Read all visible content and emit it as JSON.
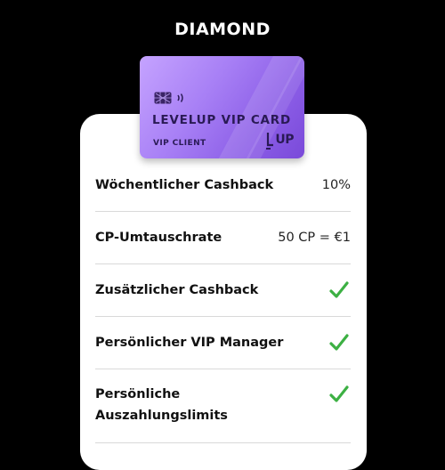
{
  "tier": {
    "title": "DIAMOND"
  },
  "card": {
    "title": "LEVELUP VIP CARD",
    "subtitle": "VIP CLIENT",
    "logo": "UP",
    "gradient_colors": [
      "#c5a3ff",
      "#7a4ad9"
    ]
  },
  "benefits": [
    {
      "label": "Wöchentlicher Cashback",
      "value": "10%"
    },
    {
      "label": "CP-Umtauschrate",
      "value": "50 CP = €1"
    },
    {
      "label": "Zusätzlicher Cashback",
      "value": null,
      "icon": "check-icon"
    },
    {
      "label": "Persönlicher VIP Manager",
      "value": null,
      "icon": "check-icon"
    },
    {
      "label_line1": "Persönliche",
      "label_line2": "Auszahlungslimits",
      "value": null,
      "icon": "check-icon"
    }
  ],
  "colors": {
    "background": "#000000",
    "panel": "#ffffff",
    "check": "#3cb043",
    "divider": "#d9d9d9"
  }
}
